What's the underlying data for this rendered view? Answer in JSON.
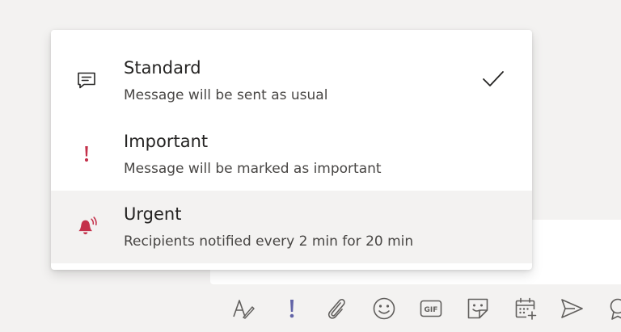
{
  "priority_menu": {
    "items": [
      {
        "title": "Standard",
        "description": "Message will be sent as usual",
        "icon": "message-icon",
        "selected": true
      },
      {
        "title": "Important",
        "description": "Message will be marked as important",
        "icon": "exclamation-icon",
        "selected": false
      },
      {
        "title": "Urgent",
        "description": "Recipients notified every 2 min for 20 min",
        "icon": "bell-ring-icon",
        "selected": false
      }
    ]
  },
  "toolbar": {
    "tools": [
      {
        "name": "format",
        "icon": "format-text-icon"
      },
      {
        "name": "priority",
        "icon": "exclamation-icon"
      },
      {
        "name": "attach",
        "icon": "paperclip-icon"
      },
      {
        "name": "emoji",
        "icon": "emoji-icon"
      },
      {
        "name": "gif",
        "icon": "gif-icon",
        "label": "GIF"
      },
      {
        "name": "sticker",
        "icon": "sticker-icon"
      },
      {
        "name": "schedule-meeting",
        "icon": "calendar-add-icon"
      },
      {
        "name": "stream",
        "icon": "send-arrow-icon"
      },
      {
        "name": "praise",
        "icon": "praise-icon"
      }
    ]
  },
  "colors": {
    "important_accent": "#c4314b",
    "toolbar_icon": "#605e5c",
    "priority_active": "#6264a7",
    "hover_background": "#f3f2f1"
  }
}
